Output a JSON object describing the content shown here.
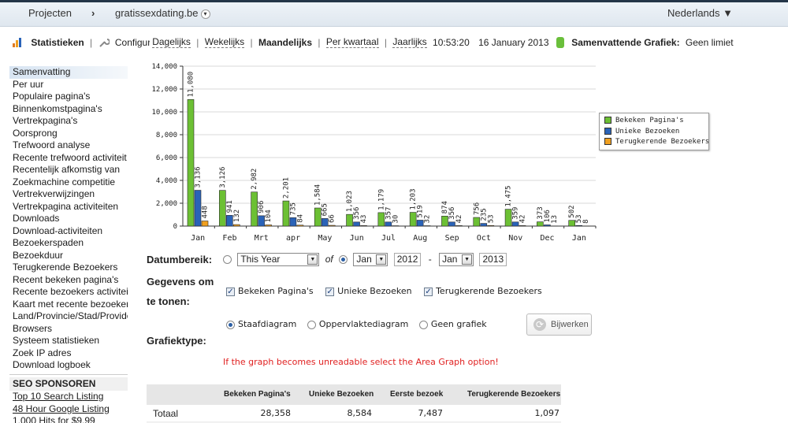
{
  "topbar": {
    "projects": "Projecten",
    "chevron": "›",
    "site": "gratissexdating.be",
    "dd": "▾",
    "language": "Nederlands ▼"
  },
  "subnav": {
    "stats": "Statistieken",
    "sep": "|",
    "config": "Configuratie",
    "daily": "Dagelijks",
    "weekly": "Wekelijks",
    "monthly": "Maandelijks",
    "quarterly": "Per kwartaal",
    "yearly": "Jaarlijks",
    "time": "10:53:20",
    "date": "16 January 2013",
    "summary_label": "Samenvattende Grafiek:",
    "summary_value": "Geen limiet"
  },
  "sidebar": {
    "items": [
      "Samenvatting",
      "Per uur",
      "Populaire pagina's",
      "Binnenkomstpagina's",
      "Vertrekpagina's",
      "Oorsprong",
      "Trefwoord analyse",
      "Recente trefwoord activiteit",
      "Recentelijk afkomstig van",
      "Zoekmachine competitie",
      "Vertrekverwijzingen",
      "Vertrekpagina activiteiten",
      "Downloads",
      "Download-activiteiten",
      "Bezoekerspaden",
      "Bezoekduur",
      "Terugkerende Bezoekers",
      "Recent bekeken pagina's",
      "Recente bezoekers activiteit",
      "Kaart met recente bezoekers",
      "Land/Provincie/Stad/Provider",
      "Browsers",
      "Systeem statistieken",
      "Zoek IP adres",
      "Download logboek"
    ],
    "seo_title": "SEO SPONSOREN",
    "seo_links": [
      "Top 10 Search Listing",
      "48 Hour Google Listing",
      "1,000 Hits for $9.99"
    ]
  },
  "colors": {
    "series1": "#6cc034",
    "series2": "#2a63b8",
    "series3": "#f0a020",
    "warn": "#e02020"
  },
  "chart_data": {
    "type": "bar",
    "categories": [
      "Jan",
      "Feb",
      "Mrt",
      "apr",
      "May",
      "Jun",
      "Jul",
      "Aug",
      "Sep",
      "Oct",
      "Nov",
      "Dec",
      "Jan"
    ],
    "series": [
      {
        "name": "Bekeken Pagina's",
        "values": [
          11080,
          3126,
          2982,
          2201,
          1584,
          1023,
          1179,
          1203,
          874,
          756,
          1475,
          373,
          502
        ]
      },
      {
        "name": "Unieke Bezoeken",
        "values": [
          3136,
          941,
          906,
          735,
          665,
          356,
          357,
          519,
          356,
          235,
          359,
          106,
          53
        ]
      },
      {
        "name": "Terugkerende Bezoekers",
        "values": [
          448,
          132,
          104,
          84,
          66,
          43,
          30,
          32,
          42,
          53,
          42,
          13,
          8
        ]
      }
    ],
    "yticks": [
      "0",
      "2,000",
      "4,000",
      "6,000",
      "8,000",
      "10,000",
      "12,000",
      "14,000"
    ],
    "ylim": [
      0,
      14000
    ],
    "grid": true,
    "legend": "right"
  },
  "controls": {
    "range_label": "Datumbereik:",
    "preset": "This Year",
    "of": "of",
    "from_month": "Jan",
    "from_year": "2012",
    "dash": "-",
    "to_month": "Jan",
    "to_year": "2013",
    "data_label_1": "Gegevens om",
    "data_label_2": "te tonen:",
    "chk_views": "Bekeken Pagina's",
    "chk_unique": "Unieke Bezoeken",
    "chk_return": "Terugkerende Bezoekers",
    "check": "✓",
    "type_label": "Grafiektype:",
    "opt_bar": "Staafdiagram",
    "opt_area": "Oppervlaktediagram",
    "opt_none": "Geen grafiek",
    "refresh": "Bijwerken",
    "refresh_icon": "⟳",
    "warning": "If the graph becomes unreadable select the Area Graph option!"
  },
  "table": {
    "headers": [
      "Bekeken Pagina's",
      "Unieke Bezoeken",
      "Eerste bezoek",
      "Terugkerende Bezoekers"
    ],
    "row_label": "Totaal",
    "values": [
      "28,358",
      "8,584",
      "7,487",
      "1,097"
    ]
  }
}
